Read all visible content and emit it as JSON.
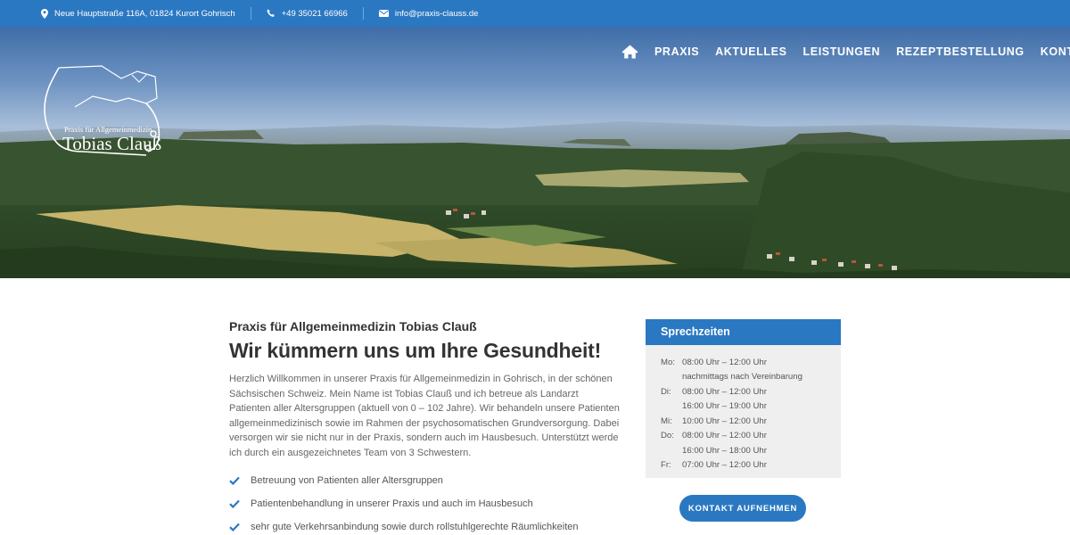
{
  "topbar": {
    "address": "Neue Hauptstraße 116A, 01824 Kurort Gohrisch",
    "phone": "+49 35021 66966",
    "email": "info@praxis-clauss.de"
  },
  "logo": {
    "line1": "Praxis für Allgemeinmedizin",
    "line2": "Tobias Clauß"
  },
  "nav": {
    "home_icon": "home-icon",
    "items": [
      "PRAXIS",
      "AKTUELLES",
      "LEISTUNGEN",
      "REZEPTBESTELLUNG",
      "KONTAKT"
    ]
  },
  "main": {
    "subtitle": "Praxis für Allgemeinmedizin Tobias Clauß",
    "headline": "Wir kümmern uns um Ihre Gesundheit!",
    "intro": "Herzlich Willkommen in unserer Praxis für Allgemeinmedizin in Gohrisch, in der schönen Sächsischen Schweiz. Mein Name ist Tobias Clauß und ich betreue als Landarzt Patienten aller Altersgruppen (aktuell von 0 – 102 Jahre). Wir behandeln unsere Patienten allgemeinmedizinisch sowie im Rahmen der psychosomatischen Grundversorgung. Dabei versorgen wir sie nicht nur in der Praxis, sondern auch im Hausbesuch. Unterstützt werde ich durch ein ausgezeichnetes Team von 3 Schwestern.",
    "bullets": [
      "Betreuung von Patienten aller Altersgruppen",
      "Patientenbehandlung in unserer Praxis und auch im Hausbesuch",
      "sehr gute Verkehrsanbindung sowie durch rollstuhlgerechte Räumlichkeiten"
    ]
  },
  "hours": {
    "title": "Sprechzeiten",
    "rows": [
      {
        "day": "Mo:",
        "time": "08:00 Uhr – 12:00 Uhr"
      },
      {
        "day": "",
        "time": "nachmittags nach Vereinbarung"
      },
      {
        "day": "Di:",
        "time": "08:00 Uhr – 12:00 Uhr"
      },
      {
        "day": "",
        "time": "16:00 Uhr – 19:00 Uhr"
      },
      {
        "day": "Mi:",
        "time": "10:00 Uhr – 12:00 Uhr"
      },
      {
        "day": "Do:",
        "time": "08:00 Uhr – 12:00 Uhr"
      },
      {
        "day": "",
        "time": "16:00 Uhr – 18:00 Uhr"
      },
      {
        "day": "Fr:",
        "time": "07:00 Uhr – 12:00 Uhr"
      }
    ]
  },
  "cta": {
    "label": "KONTAKT AUFNEHMEN"
  },
  "colors": {
    "brand_blue": "#2b78c2",
    "panel_gray": "#efefef",
    "text_dark": "#333333"
  }
}
